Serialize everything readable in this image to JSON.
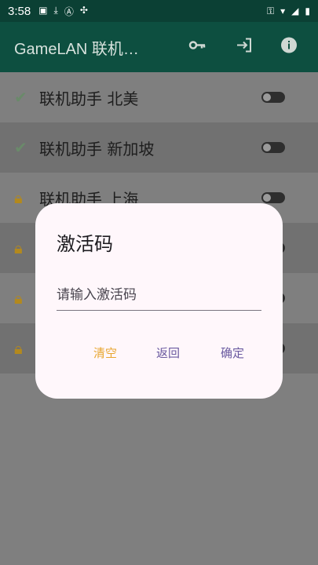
{
  "status_bar": {
    "time": "3:58"
  },
  "app_bar": {
    "title": "GameLAN 联机…",
    "icons": [
      "key-icon",
      "exit-icon",
      "info-icon"
    ]
  },
  "servers": [
    {
      "label": "联机助手 北美",
      "status_icon": "check-icon",
      "enabled": false
    },
    {
      "label": "联机助手 新加坡",
      "status_icon": "check-icon",
      "enabled": false
    },
    {
      "label": "联机助手 上海",
      "status_icon": "lock-icon",
      "enabled": false
    },
    {
      "label": "",
      "status_icon": "lock-icon",
      "enabled": false
    },
    {
      "label": "",
      "status_icon": "lock-icon",
      "enabled": false
    },
    {
      "label": "",
      "status_icon": "lock-icon",
      "enabled": false
    }
  ],
  "dialog": {
    "title": "激活码",
    "input_placeholder": "请输入激活码",
    "input_value": "",
    "clear_label": "清空",
    "back_label": "返回",
    "confirm_label": "确定"
  },
  "colors": {
    "status_bar": "#0b4034",
    "app_bar": "#0d4f40",
    "scrim": "#7f7f7f",
    "dialog_bg": "#fff7fb",
    "clear_button": "#e8a630",
    "action_button": "#6a5aa0",
    "lock": "#b3891d"
  }
}
